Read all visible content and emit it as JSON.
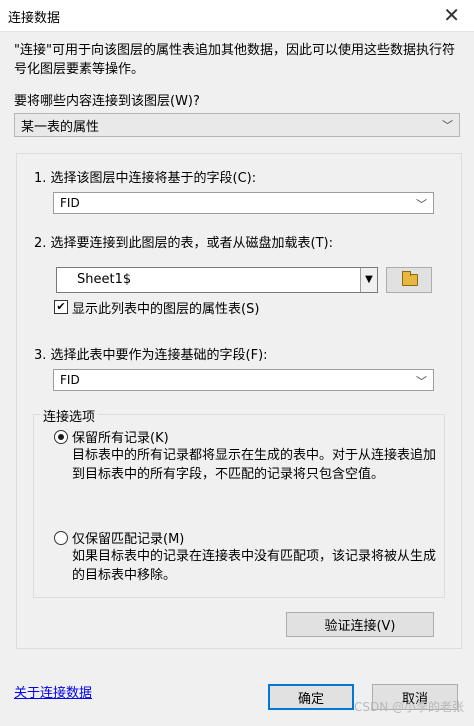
{
  "window": {
    "title": "连接数据",
    "close_glyph": "✕"
  },
  "intro": "\"连接\"可用于向该图层的属性表追加其他数据，因此可以使用这些数据执行符号化图层要素等操作。",
  "question_label": "要将哪些内容连接到该图层(W)?",
  "join_type": {
    "value": "某一表的属性"
  },
  "step1": {
    "label": "1. 选择该图层中连接将基于的字段(C):",
    "value": "FID"
  },
  "step2": {
    "label": "2. 选择要连接到此图层的表，或者从磁盘加载表(T):",
    "table_value": "Sheet1$",
    "show_attr_label": "显示此列表中的图层的属性表(S)",
    "show_attr_checked": true
  },
  "step3": {
    "label": "3. 选择此表中要作为连接基础的字段(F):",
    "value": "FID"
  },
  "options": {
    "legend": "连接选项",
    "keep_all": {
      "label": "保留所有记录(K)",
      "desc": "目标表中的所有记录都将显示在生成的表中。对于从连接表追加到目标表中的所有字段，不匹配的记录将只包含空值。",
      "selected": true
    },
    "keep_matching": {
      "label": "仅保留匹配记录(M)",
      "desc": "如果目标表中的记录在连接表中没有匹配项，该记录将被从生成的目标表中移除。",
      "selected": false
    }
  },
  "validate_button": "验证连接(V)",
  "about_link": "关于连接数据",
  "ok_button": "确定",
  "cancel_button": "取消",
  "watermark": "CSDN @小李的老张"
}
